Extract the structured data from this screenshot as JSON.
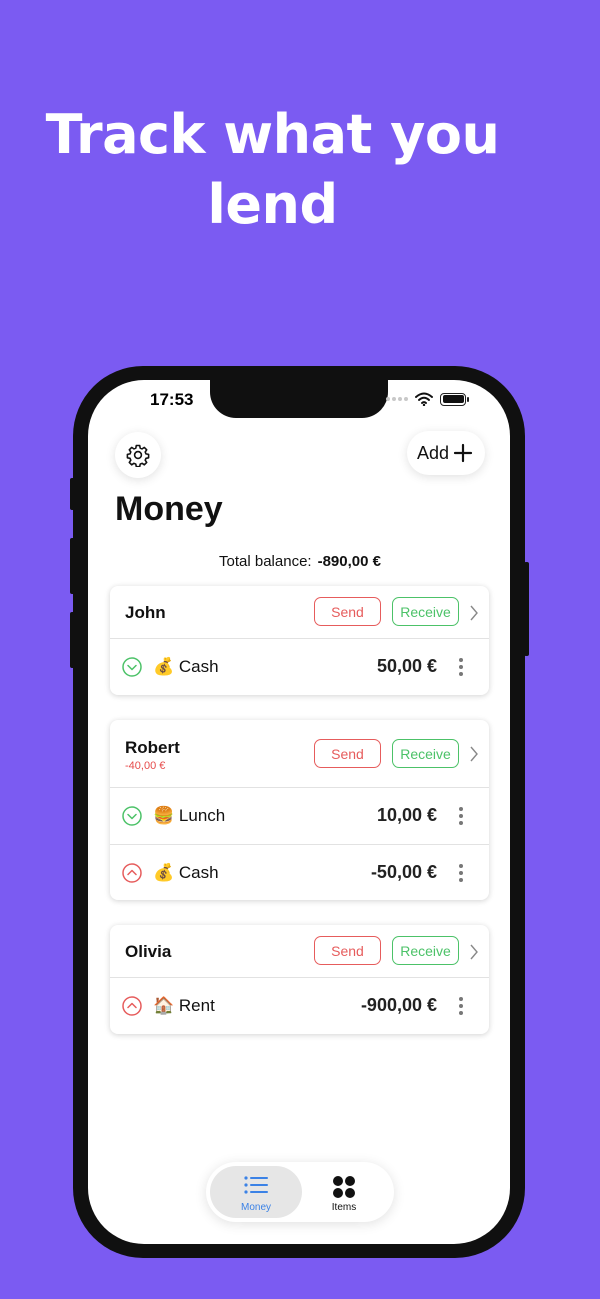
{
  "promo": {
    "headline_line1": "Track what you",
    "headline_line2": "lend"
  },
  "status_bar": {
    "time": "17:53"
  },
  "header": {
    "add_label": "Add",
    "title": "Money"
  },
  "balance": {
    "label": "Total balance:",
    "value": "-890,00 €"
  },
  "buttons": {
    "send": "Send",
    "receive": "Receive"
  },
  "people": [
    {
      "name": "John",
      "subtitle": "",
      "entries": [
        {
          "direction": "receive",
          "emoji": "💰",
          "label": "Cash",
          "amount": "50,00 €"
        }
      ]
    },
    {
      "name": "Robert",
      "subtitle": "-40,00 €",
      "entries": [
        {
          "direction": "receive",
          "emoji": "🍔",
          "label": "Lunch",
          "amount": "10,00 €"
        },
        {
          "direction": "send",
          "emoji": "💰",
          "label": "Cash",
          "amount": "-50,00 €"
        }
      ]
    },
    {
      "name": "Olivia",
      "subtitle": "",
      "entries": [
        {
          "direction": "send",
          "emoji": "🏠",
          "label": "Rent",
          "amount": "-900,00 €"
        }
      ]
    }
  ],
  "tabs": {
    "money": "Money",
    "items": "Items"
  },
  "colors": {
    "background": "#7B5BF2",
    "send": "#E65C5C",
    "receive": "#4CC268",
    "active_tab": "#3B82E6"
  }
}
